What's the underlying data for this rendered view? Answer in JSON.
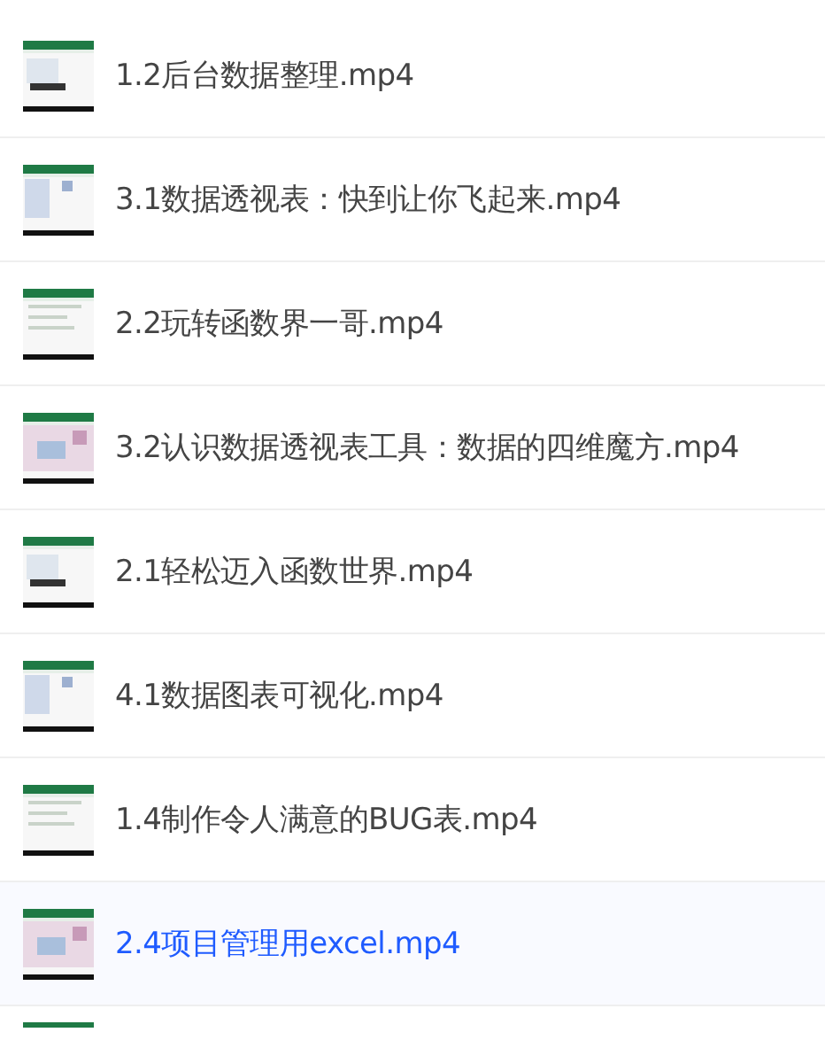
{
  "videos": [
    {
      "title": "1.2后台数据整理.mp4",
      "selected": false
    },
    {
      "title": "3.1数据透视表：快到让你飞起来.mp4",
      "selected": false
    },
    {
      "title": "2.2玩转函数界一哥.mp4",
      "selected": false
    },
    {
      "title": "3.2认识数据透视表工具：数据的四维魔方.mp4",
      "selected": false
    },
    {
      "title": "2.1轻松迈入函数世界.mp4",
      "selected": false
    },
    {
      "title": "4.1数据图表可视化.mp4",
      "selected": false
    },
    {
      "title": "1.4制作令人满意的BUG表.mp4",
      "selected": false
    },
    {
      "title": "2.4项目管理用excel.mp4",
      "selected": true
    },
    {
      "kind": "picture"
    }
  ]
}
